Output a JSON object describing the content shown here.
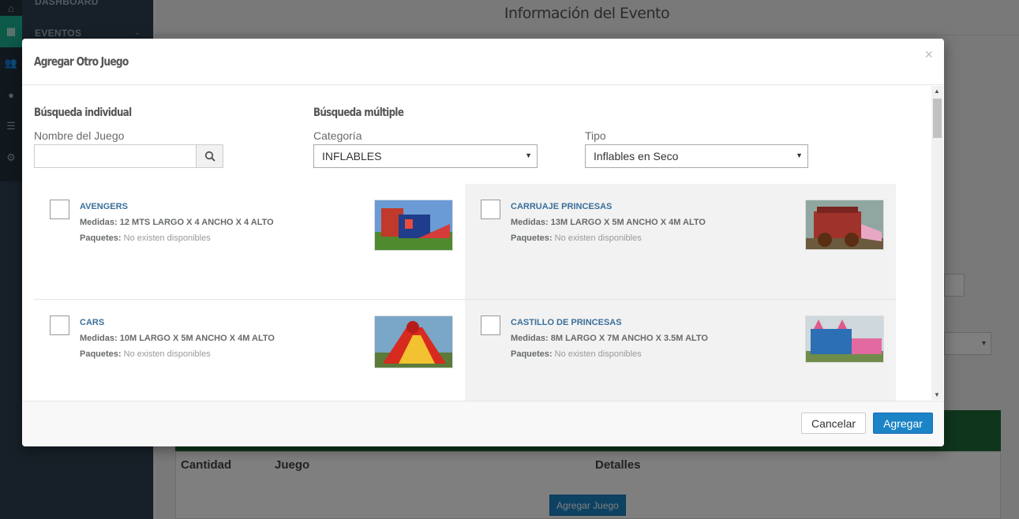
{
  "background": {
    "nav": {
      "dashboard": "DASHBOARD",
      "eventos": "EVENTOS"
    },
    "page_title": "Información del Evento",
    "table_headers": [
      "Cantidad",
      "Juego",
      "Detalles"
    ],
    "add_game_button": "Agregar Juego"
  },
  "modal": {
    "title": "Agregar Otro Juego",
    "close": "×",
    "individual": {
      "title": "Búsqueda individual",
      "label": "Nombre del Juego",
      "value": ""
    },
    "multiple": {
      "title": "Búsqueda múltiple",
      "category": {
        "label": "Categoría",
        "value": "INFLABLES"
      },
      "type": {
        "label": "Tipo",
        "value": "Inflables en Seco"
      }
    },
    "items": [
      {
        "name": "AVENGERS",
        "measures_label": "Medidas:",
        "measures": "12 MTS LARGO X 4 ANCHO X 4 ALTO",
        "packages_label": "Paquetes:",
        "packages": "No existen disponibles"
      },
      {
        "name": "CARRUAJE PRINCESAS",
        "measures_label": "Medidas:",
        "measures": "13M LARGO X 5M ANCHO X 4M ALTO",
        "packages_label": "Paquetes:",
        "packages": "No existen disponibles"
      },
      {
        "name": "CARS",
        "measures_label": "Medidas:",
        "measures": "10M LARGO X 5M ANCHO X 4M ALTO",
        "packages_label": "Paquetes:",
        "packages": "No existen disponibles"
      },
      {
        "name": "CASTILLO DE PRINCESAS",
        "measures_label": "Medidas:",
        "measures": "8M LARGO X 7M ANCHO X 3.5M ALTO",
        "packages_label": "Paquetes:",
        "packages": "No existen disponibles"
      }
    ],
    "cancel_label": "Cancelar",
    "add_label": "Agregar"
  },
  "colors": {
    "accent": "#1c84c6",
    "link": "#3a6f9a",
    "overlay": "#000000"
  }
}
